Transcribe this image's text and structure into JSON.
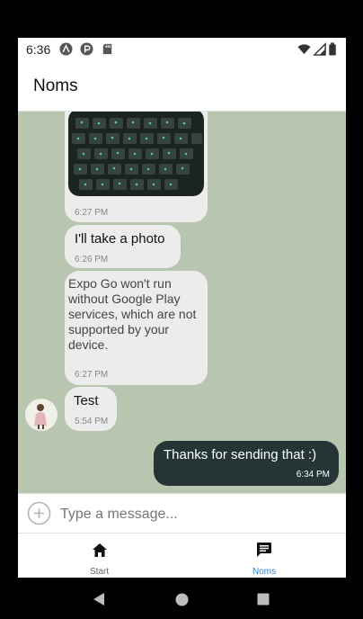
{
  "status_bar": {
    "time": "6:36"
  },
  "app_bar": {
    "title": "Noms"
  },
  "messages": [
    {
      "type": "image",
      "timestamp": "6:27 PM"
    },
    {
      "type": "text",
      "text": "I'll take a photo",
      "timestamp": "6:26 PM"
    },
    {
      "type": "text",
      "text": "Expo Go won't run without Google Play services, which are not supported by your device.",
      "timestamp": "6:27 PM"
    },
    {
      "type": "text",
      "text": "Test",
      "timestamp": "5:54 PM"
    },
    {
      "type": "text",
      "text": "Thanks for sending that :)",
      "timestamp": "6:34 PM",
      "outgoing": true
    }
  ],
  "composer": {
    "placeholder": "Type a message..."
  },
  "tabs": [
    {
      "label": "Start",
      "icon": "home-icon",
      "active": false
    },
    {
      "label": "Noms",
      "icon": "chat-icon",
      "active": true
    }
  ],
  "colors": {
    "accent": "#2f7fd6",
    "chat_background": "#b8c6b0",
    "outgoing_bubble": "#253535",
    "incoming_bubble": "#ececec"
  }
}
